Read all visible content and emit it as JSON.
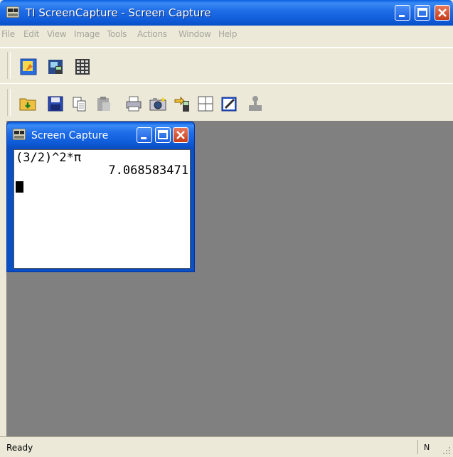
{
  "window": {
    "title": "TI ScreenCapture - Screen Capture"
  },
  "menu": [
    "File",
    "Edit",
    "View",
    "Image",
    "Tools",
    "Actions",
    "Window",
    "Help"
  ],
  "toolbar1": {
    "buttons": [
      "capture-screen-icon",
      "capture-handheld-icon",
      "capture-grid-icon"
    ]
  },
  "toolbar2": {
    "buttons": [
      "open-folder-icon",
      "save-disk-icon",
      "copy-icon",
      "paste-icon",
      "print-icon",
      "camera-icon",
      "send-to-device-icon",
      "grid-icon",
      "edit-brush-icon",
      "stamp-icon"
    ]
  },
  "child_window": {
    "title": "Screen Capture"
  },
  "calculator": {
    "line1": "(3/2)^2*π",
    "line2": "7.068583471"
  },
  "status": {
    "text": "Ready",
    "indicator": "N"
  },
  "colors": {
    "title_bar": "#0a5fe0",
    "close_button": "#c63c1a",
    "workspace": "#808080"
  }
}
